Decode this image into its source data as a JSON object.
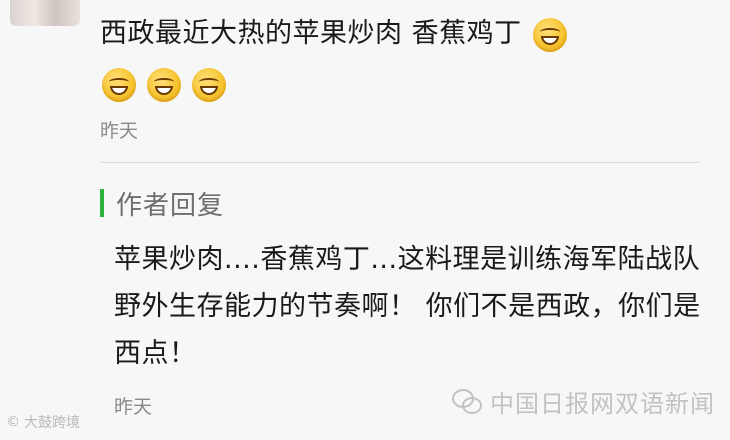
{
  "comment": {
    "text": "西政最近大热的苹果炒肉 香蕉鸡丁",
    "emoji_icon": "grin-emoji-icon",
    "emoji_count_trailing": 1,
    "emoji_count_row": 3,
    "timestamp": "昨天"
  },
  "reply": {
    "label": "作者回复",
    "accent_color": "#2cb33b",
    "text": "苹果炒肉....香蕉鸡丁...这料理是训练海军陆战队野外生存能力的节奏啊！ 你们不是西政，你们是西点！",
    "timestamp": "昨天"
  },
  "watermarks": {
    "left": "大鼓跨境",
    "right": "中国日报网双语新闻"
  }
}
